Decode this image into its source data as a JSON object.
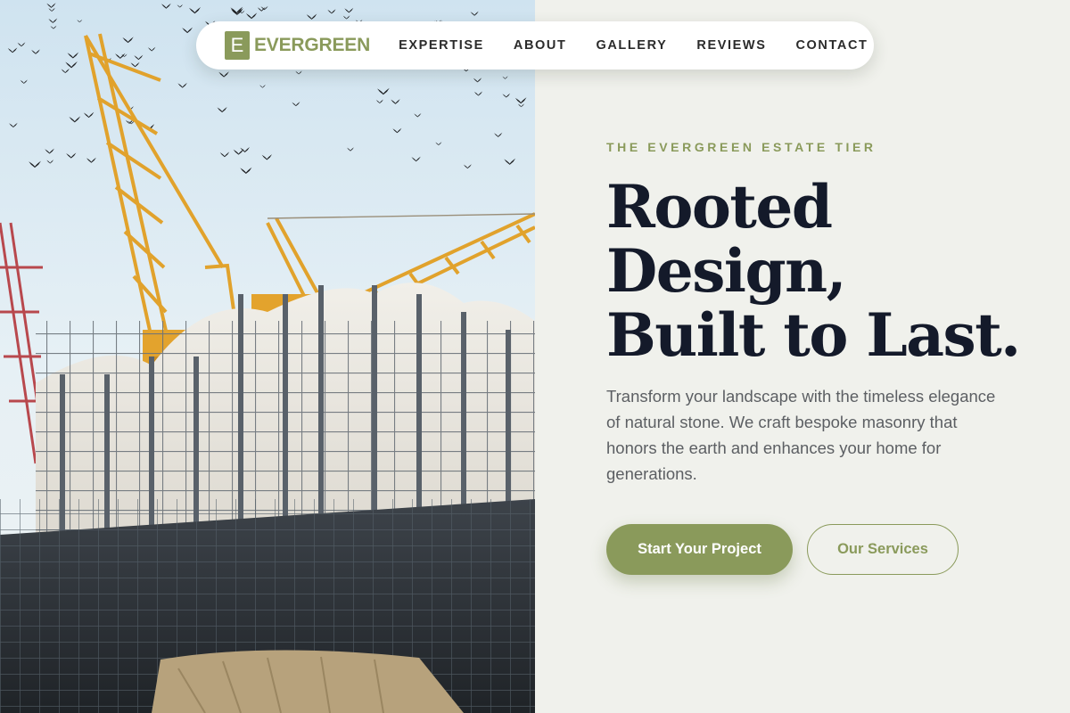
{
  "brand": {
    "logo_letter": "E",
    "name": "EVERGREEN"
  },
  "nav": {
    "items": [
      {
        "label": "EXPERTISE"
      },
      {
        "label": "ABOUT"
      },
      {
        "label": "GALLERY"
      },
      {
        "label": "REVIEWS"
      },
      {
        "label": "CONTACT"
      }
    ]
  },
  "hero": {
    "eyebrow": "THE EVERGREEN ESTATE TIER",
    "headline_lines": [
      "Rooted",
      "Design,",
      "Built to Last."
    ],
    "description": "Transform your landscape with the timeless elegance of natural stone. We craft bespoke masonry that honors the earth and enhances your home for generations.",
    "primary_cta": "Start Your Project",
    "secondary_cta": "Our Services"
  },
  "colors": {
    "accent": "#8a9a5b",
    "heading": "#141a2a",
    "body_text": "#5c5f63",
    "background": "#f0f1ec"
  },
  "image": {
    "subject": "construction-site-with-cranes-photo"
  }
}
